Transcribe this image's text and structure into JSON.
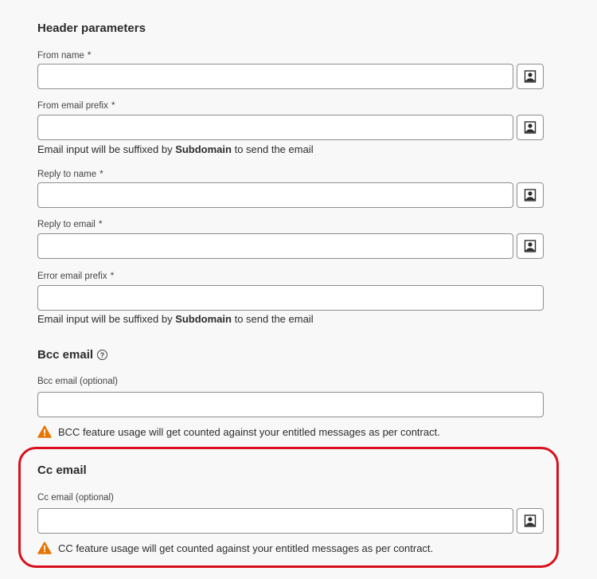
{
  "header_parameters": {
    "title": "Header parameters",
    "from_name": {
      "label": "From name",
      "required": "*",
      "value": ""
    },
    "from_email_prefix": {
      "label": "From email prefix",
      "required": "*",
      "value": "",
      "help_pre": "Email input will be suffixed by ",
      "help_bold": "Subdomain",
      "help_post": " to send the email"
    },
    "reply_to_name": {
      "label": "Reply to name",
      "required": "*",
      "value": ""
    },
    "reply_to_email": {
      "label": "Reply to email",
      "required": "*",
      "value": ""
    },
    "error_email_prefix": {
      "label": "Error email prefix",
      "required": "*",
      "value": "",
      "help_pre": "Email input will be suffixed by ",
      "help_bold": "Subdomain",
      "help_post": " to send the email"
    }
  },
  "bcc": {
    "title": "Bcc email",
    "help_icon": "?",
    "field_label": "Bcc email (optional)",
    "value": "",
    "warning": "BCC feature usage will get counted against your entitled messages as per contract."
  },
  "cc": {
    "title": "Cc email",
    "field_label": "Cc email (optional)",
    "value": "",
    "warning": "CC feature usage will get counted against your entitled messages as per contract."
  },
  "colors": {
    "highlight": "#d9101b",
    "warning_icon": "#e67400"
  }
}
